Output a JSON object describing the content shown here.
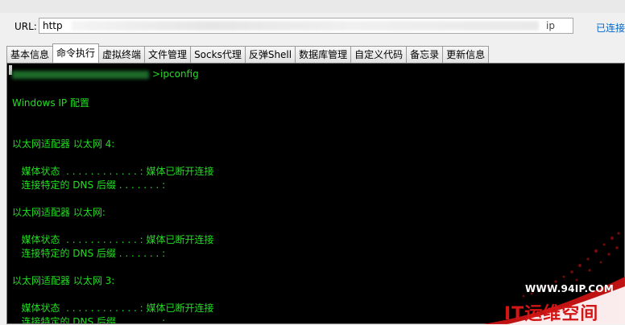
{
  "url_bar": {
    "label": "URL:",
    "value_prefix": "http",
    "value_suffix": "ip",
    "status": "已连接"
  },
  "tabs": [
    {
      "label": "基本信息"
    },
    {
      "label": "命令执行",
      "active": true
    },
    {
      "label": "虚拟终端"
    },
    {
      "label": "文件管理"
    },
    {
      "label": "Socks代理"
    },
    {
      "label": "反弹Shell"
    },
    {
      "label": "数据库管理"
    },
    {
      "label": "自定义代码"
    },
    {
      "label": "备忘录"
    },
    {
      "label": "更新信息"
    }
  ],
  "terminal": {
    "command": ">ipconfig",
    "lines": [
      "Windows IP 配置",
      "以太网适配器 以太网 4:",
      "   媒体状态  . . . . . . . . . . . . : 媒体已断开连接",
      "   连接特定的 DNS 后缀 . . . . . . . :",
      "以太网适配器 以太网:",
      "   媒体状态  . . . . . . . . . . . . : 媒体已断开连接",
      "   连接特定的 DNS 后缀 . . . . . . . :",
      "以太网适配器 以太网 3:",
      "   媒体状态  . . . . . . . . . . . . : 媒体已断开连接",
      "   连接特定的 DNS 后缀 . . . . . . . :"
    ],
    "text_color": "#22dd22",
    "background": "#000000"
  },
  "watermark": {
    "site": "WWW.94IP.COM",
    "brand": "IT运维空间",
    "color": "#d41515"
  }
}
